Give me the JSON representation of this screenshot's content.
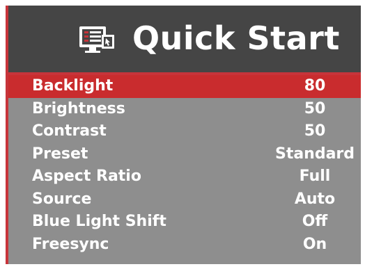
{
  "header": {
    "title": "Quick Start",
    "icon": "monitor-menu-icon"
  },
  "colors": {
    "accent": "#c92c2e",
    "header_bg": "#454545",
    "panel_bg": "#8e8e8e",
    "text": "#ffffff"
  },
  "menu": {
    "selected_index": 0,
    "items": [
      {
        "label": "Backlight",
        "value": "80"
      },
      {
        "label": "Brightness",
        "value": "50"
      },
      {
        "label": "Contrast",
        "value": "50"
      },
      {
        "label": "Preset",
        "value": "Standard"
      },
      {
        "label": "Aspect Ratio",
        "value": "Full"
      },
      {
        "label": "Source",
        "value": "Auto"
      },
      {
        "label": "Blue Light Shift",
        "value": "Off"
      },
      {
        "label": "Freesync",
        "value": "On"
      }
    ]
  }
}
